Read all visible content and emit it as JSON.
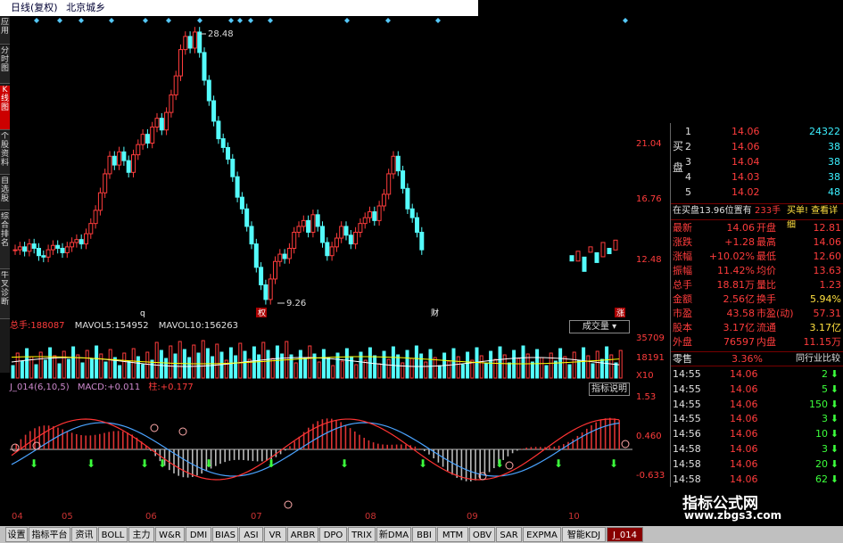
{
  "topbar": {
    "period": "日线(复权)",
    "stock": "北京城乡"
  },
  "left_tabs": [
    "应用",
    "分时图",
    "K线图",
    "个股资料",
    "自选股",
    "综合排名",
    "牛叉诊断"
  ],
  "main": {
    "peak_label": "28.48",
    "low_label": "9.26",
    "y_ticks": [
      "21.04",
      "16.76",
      "12.48"
    ],
    "marker_labels": [
      "q",
      "权",
      "财",
      "涨"
    ],
    "diamond_count": 15
  },
  "volume": {
    "total_label": "总手:",
    "total_value": "188087",
    "mavol5_label": "MAVOL5:",
    "mavol5_value": "154952",
    "mavol10_label": "MAVOL10:",
    "mavol10_value": "156263",
    "dropdown": "成交量",
    "y_ticks": [
      "35709",
      "18191",
      "X10"
    ]
  },
  "macd": {
    "name": "J_014(6,10,5)",
    "macd_label": "MACD:",
    "macd_value": "+0.011",
    "hist_label": "柱:",
    "hist_value": "+0.177",
    "button": "指标说明",
    "y_ticks": [
      "1.53",
      "0.460",
      "-0.633"
    ]
  },
  "dates": [
    "04",
    "05",
    "06",
    "07",
    "08",
    "09",
    "10"
  ],
  "quote": {
    "bid_label": "买盘",
    "bids": [
      {
        "n": "1",
        "price": "14.06",
        "vol": "24322"
      },
      {
        "n": "2",
        "price": "14.06",
        "vol": "38"
      },
      {
        "n": "3",
        "price": "14.04",
        "vol": "38"
      },
      {
        "n": "4",
        "price": "14.03",
        "vol": "38"
      },
      {
        "n": "5",
        "price": "14.02",
        "vol": "48"
      }
    ],
    "buy_note": "在买盘13.96位置有",
    "buy_count": "233手",
    "buy_link": "买单! 查看详细",
    "stats": [
      {
        "l1": "最新",
        "v1": "14.06",
        "l2": "开盘",
        "v2": "12.81"
      },
      {
        "l1": "涨跌",
        "v1": "+1.28",
        "l2": "最高",
        "v2": "14.06"
      },
      {
        "l1": "涨幅",
        "v1": "+10.02%",
        "l2": "最低",
        "v2": "12.60"
      },
      {
        "l1": "振幅",
        "v1": "11.42%",
        "l2": "均价",
        "v2": "13.63"
      },
      {
        "l1": "总手",
        "v1": "18.81万",
        "l2": "量比",
        "v2": "1.23"
      },
      {
        "l1": "金额",
        "v1": "2.56亿",
        "l2": "换手",
        "v2": "5.94%"
      },
      {
        "l1": "市盈",
        "v1": "43.58",
        "l2": "市盈(动)",
        "v2": "57.31"
      },
      {
        "l1": "股本",
        "v1": "3.17亿",
        "l2": "流通",
        "v2": "3.17亿"
      },
      {
        "l1": "外盘",
        "v1": "76597",
        "l2": "内盘",
        "v2": "11.15万"
      }
    ],
    "industry_label": "零售",
    "industry_change": "3.36%",
    "industry_link": "同行业比较",
    "ticks": [
      {
        "t": "14:55",
        "p": "14.06",
        "v": "2"
      },
      {
        "t": "14:55",
        "p": "14.06",
        "v": "5"
      },
      {
        "t": "14:55",
        "p": "14.06",
        "v": "150"
      },
      {
        "t": "14:55",
        "p": "14.06",
        "v": "3"
      },
      {
        "t": "14:56",
        "p": "14.06",
        "v": "10"
      },
      {
        "t": "14:58",
        "p": "14.06",
        "v": "3"
      },
      {
        "t": "14:58",
        "p": "14.06",
        "v": "20"
      },
      {
        "t": "14:58",
        "p": "14.06",
        "v": "62"
      },
      {
        "t": "14:58",
        "p": "14.06",
        "v": ""
      }
    ]
  },
  "bottom_tabs": [
    "设置",
    "指标平台",
    "资讯",
    "BOLL",
    "主力",
    "W&R",
    "DMI",
    "BIAS",
    "ASI",
    "VR",
    "ARBR",
    "DPO",
    "TRIX",
    "新DMA",
    "BBI",
    "MTM",
    "OBV",
    "SAR",
    "EXPMA",
    "智能KDJ",
    "J_014"
  ],
  "watermark": {
    "title": "指标公式网",
    "url": "www.zbgs3.com"
  },
  "colors": {
    "up": "#ff3c3c",
    "down": "#54fcfc",
    "arrow": "#3cff3c",
    "bg": "#000000"
  }
}
